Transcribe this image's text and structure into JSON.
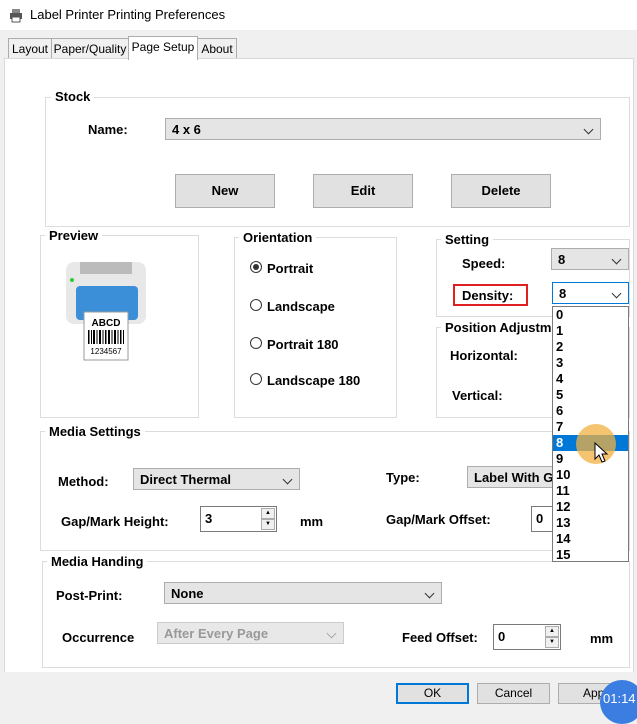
{
  "window": {
    "title": "Label Printer Printing Preferences"
  },
  "tabs": [
    {
      "label": "Layout"
    },
    {
      "label": "Paper/Quality"
    },
    {
      "label": "Page Setup"
    },
    {
      "label": "About"
    }
  ],
  "stock": {
    "group_label": "Stock",
    "name_label": "Name:",
    "name_value": "4 x 6",
    "new_label": "New",
    "edit_label": "Edit",
    "delete_label": "Delete"
  },
  "preview": {
    "group_label": "Preview",
    "label_text": "ABCD",
    "barcode_number": "1234567"
  },
  "orientation": {
    "group_label": "Orientation",
    "options": [
      "Portrait",
      "Landscape",
      "Portrait 180",
      "Landscape 180"
    ],
    "selected": "Portrait"
  },
  "setting": {
    "group_label": "Setting",
    "speed_label": "Speed:",
    "speed_value": "8",
    "density_label": "Density:",
    "density_value": "8",
    "density_options": [
      "0",
      "1",
      "2",
      "3",
      "4",
      "5",
      "6",
      "7",
      "8",
      "9",
      "10",
      "11",
      "12",
      "13",
      "14",
      "15"
    ],
    "density_highlighted": "8"
  },
  "position": {
    "group_label": "Position Adjustm",
    "horizontal_label": "Horizontal:",
    "vertical_label": "Vertical:"
  },
  "media_settings": {
    "group_label": "Media Settings",
    "method_label": "Method:",
    "method_value": "Direct Thermal",
    "type_label": "Type:",
    "type_value": "Label With G",
    "gap_height_label": "Gap/Mark Height:",
    "gap_height_value": "3",
    "gap_height_unit": "mm",
    "gap_offset_label": "Gap/Mark Offset:",
    "gap_offset_value": "0"
  },
  "media_handling": {
    "group_label": "Media Handing",
    "post_print_label": "Post-Print:",
    "post_print_value": "None",
    "occurrence_label": "Occurrence",
    "occurrence_value": "After Every Page",
    "feed_offset_label": "Feed Offset:",
    "feed_offset_value": "0",
    "feed_offset_unit": "mm"
  },
  "footer": {
    "ok_label": "OK",
    "cancel_label": "Cancel",
    "apply_label": "App"
  },
  "overlay": {
    "timer": "01:14"
  },
  "colors": {
    "accent": "#0078d7",
    "highlight_box": "#e02020",
    "cursor_halo": "#f0b040"
  }
}
